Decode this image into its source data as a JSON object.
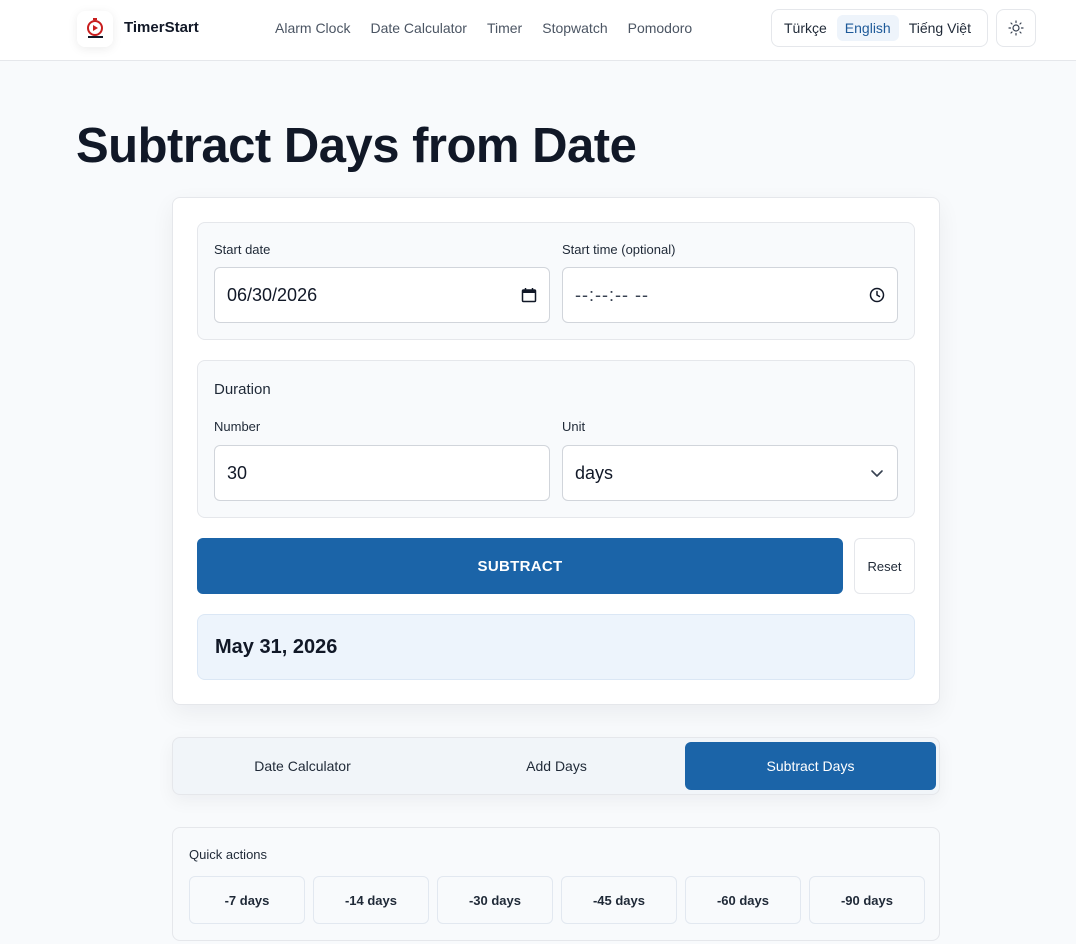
{
  "header": {
    "brand": "TimerStart",
    "nav": [
      "Alarm Clock",
      "Date Calculator",
      "Timer",
      "Stopwatch",
      "Pomodoro"
    ],
    "languages": [
      "Türkçe",
      "English",
      "Tiếng Việt"
    ],
    "active_language": "English",
    "logo_icon": "timer-logo-icon",
    "theme_icon": "sun-icon"
  },
  "page": {
    "title": "Subtract Days from Date"
  },
  "form": {
    "start_date_label": "Start date",
    "start_date_value": "06/30/2026",
    "start_time_label": "Start time (optional)",
    "start_time_value": "--:--:-- --",
    "duration_heading": "Duration",
    "number_label": "Number",
    "number_value": "30",
    "unit_label": "Unit",
    "unit_value": "days",
    "subtract_label": "SUBTRACT",
    "reset_label": "Reset"
  },
  "result": {
    "value": "May 31, 2026"
  },
  "tabs": [
    "Date Calculator",
    "Add Days",
    "Subtract Days"
  ],
  "active_tab": "Subtract Days",
  "quick_actions": {
    "title": "Quick actions",
    "items": [
      "-7 days",
      "-14 days",
      "-30 days",
      "-45 days",
      "-60 days",
      "-90 days"
    ]
  },
  "colors": {
    "primary": "#1b64a8",
    "result_bg": "#edf4fc",
    "background": "#f8fafc"
  }
}
